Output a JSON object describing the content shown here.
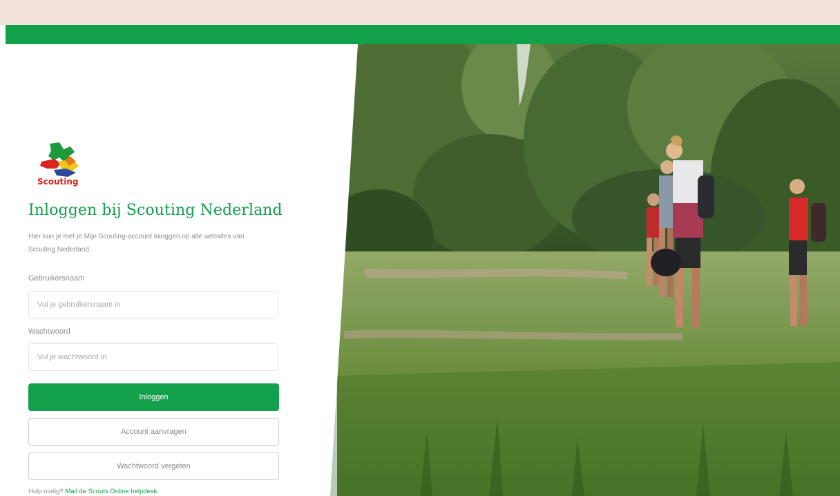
{
  "logo": {
    "text": "Scouting",
    "icon": "scouting-logo"
  },
  "title": "Inloggen bij Scouting Nederland",
  "description": "Hier kun je met je Mijn Scouting-account inloggen op alle websites van Scouting Nederland.",
  "form": {
    "username_label": "Gebruikersnaam",
    "username_placeholder": "Vul je gebruikersnaam in",
    "username_value": "",
    "password_label": "Wachtwoord",
    "password_placeholder": "Vul je wachtwoord in",
    "password_value": ""
  },
  "buttons": {
    "login": "Inloggen",
    "request_account": "Account aanvragen",
    "forgot_password": "Wachtwoord vergeten"
  },
  "help": {
    "prefix": "Hulp nodig?",
    "link": "Mail de Scouts Online helpdesk."
  },
  "colors": {
    "brand_green": "#13a04b",
    "top_strip": "#f3e3da",
    "logo_red": "#d9261c"
  }
}
